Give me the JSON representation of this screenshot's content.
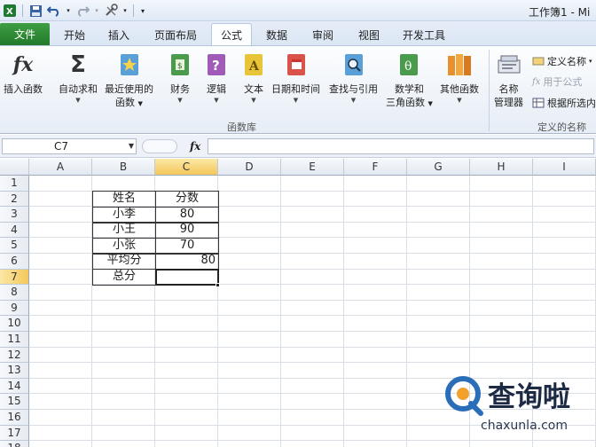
{
  "window": {
    "title": "工作簿1 - Mi"
  },
  "tabs": {
    "file": "文件",
    "items": [
      "开始",
      "插入",
      "页面布局",
      "公式",
      "数据",
      "审阅",
      "视图",
      "开发工具"
    ],
    "active": "公式"
  },
  "ribbon": {
    "insert_function": "插入函数",
    "autosum": "自动求和",
    "recent": [
      "最近使用的",
      "函数"
    ],
    "financial": "财务",
    "logical": "逻辑",
    "text": "文本",
    "datetime": "日期和时间",
    "lookup": "查找与引用",
    "math": [
      "数学和",
      "三角函数"
    ],
    "more": "其他函数",
    "group_library": "函数库",
    "name_manager": [
      "名称",
      "管理器"
    ],
    "define_name": "定义名称",
    "use_in_formula": "用于公式",
    "create_from_selection": "根据所选内",
    "group_defined_names": "定义的名称"
  },
  "formula_bar": {
    "name_box": "C7",
    "fx_label": "fx",
    "formula": ""
  },
  "grid": {
    "columns": [
      "A",
      "B",
      "C",
      "D",
      "E",
      "F",
      "G",
      "H",
      "I"
    ],
    "rows": [
      "1",
      "2",
      "3",
      "4",
      "5",
      "6",
      "7",
      "8",
      "9",
      "10",
      "11",
      "12",
      "13",
      "14",
      "15",
      "16",
      "17",
      "18"
    ],
    "selected_column": "C",
    "selected_row": "7",
    "cells": {
      "B2": "姓名",
      "C2": "分数",
      "B3": "小李",
      "C3": "80",
      "B4": "小王",
      "C4": "90",
      "B5": "小张",
      "C5": "70",
      "B6": "平均分",
      "C6": "80",
      "B7": "总分",
      "C7": ""
    }
  },
  "watermark": {
    "brand": "查询啦",
    "url": "chaxunla.com"
  },
  "colors": {
    "file_tab": "#2e8b37",
    "selection_header": "#f5c75a",
    "accent_blue": "#2a6db8"
  }
}
